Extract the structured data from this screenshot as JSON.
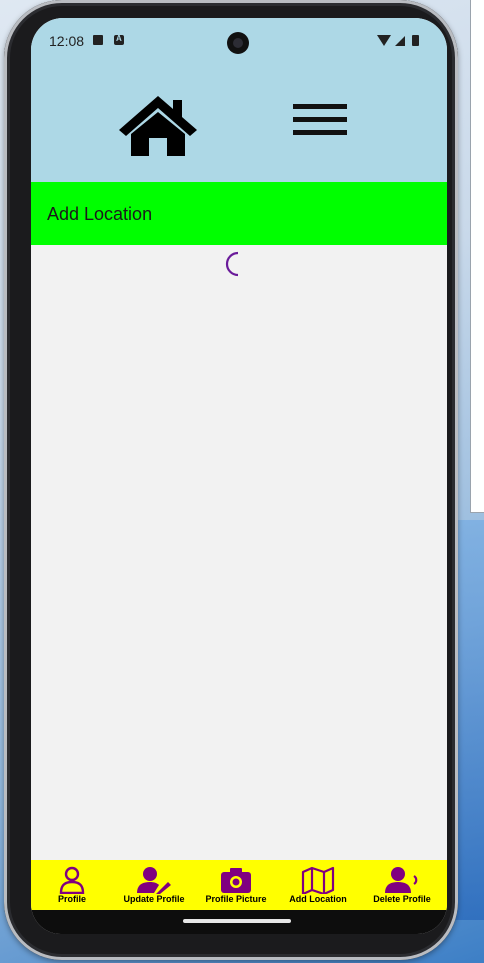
{
  "status_bar": {
    "time": "12:08",
    "icons": [
      "sd-card-icon",
      "a-notification-icon",
      "wifi-icon",
      "signal-icon",
      "battery-icon"
    ]
  },
  "header": {
    "icons": [
      "home-icon",
      "hamburger-menu-icon"
    ],
    "background": "#add8e6"
  },
  "title_bar": {
    "title": "Add Location",
    "background": "#00ff00"
  },
  "content": {
    "loading_indicator": "spinner-icon",
    "accent": "#6a1b9a"
  },
  "bottom_nav": {
    "background": "#ffff00",
    "icon_color": "#800080",
    "items": [
      {
        "label": "Profile",
        "icon": "person-outline-icon"
      },
      {
        "label": "Update Profile",
        "icon": "person-edit-icon"
      },
      {
        "label": "Profile Picture",
        "icon": "camera-icon"
      },
      {
        "label": "Add Location",
        "icon": "map-icon"
      },
      {
        "label": "Delete Profile",
        "icon": "person-remove-icon"
      }
    ]
  }
}
